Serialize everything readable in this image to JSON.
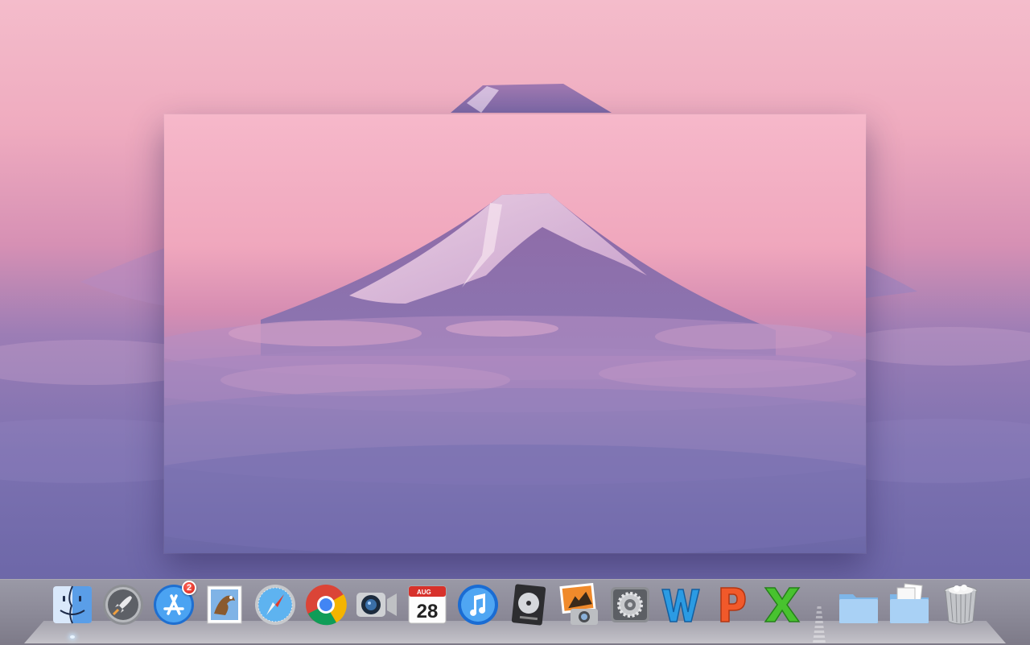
{
  "dock": {
    "apps": [
      {
        "id": "finder",
        "icon": "finder-icon",
        "running": true
      },
      {
        "id": "launchpad",
        "icon": "launchpad-rocket-icon",
        "running": false
      },
      {
        "id": "app-store",
        "icon": "app-store-icon",
        "running": false,
        "badge": "2"
      },
      {
        "id": "mail",
        "icon": "mail-stamp-eagle-icon",
        "running": false
      },
      {
        "id": "safari",
        "icon": "safari-compass-icon",
        "running": false
      },
      {
        "id": "chrome",
        "icon": "chrome-icon",
        "running": false
      },
      {
        "id": "facetime",
        "icon": "facetime-camera-icon",
        "running": false
      },
      {
        "id": "calendar",
        "icon": "calendar-icon",
        "running": false,
        "month": "AUG",
        "day": "28"
      },
      {
        "id": "itunes",
        "icon": "itunes-note-icon",
        "running": false
      },
      {
        "id": "dvd-player",
        "icon": "dvd-player-icon",
        "running": false
      },
      {
        "id": "iphoto",
        "icon": "iphoto-icon",
        "running": false
      },
      {
        "id": "system-preferences",
        "icon": "system-preferences-gear-icon",
        "running": false
      },
      {
        "id": "word",
        "icon": "word-w-icon",
        "running": false
      },
      {
        "id": "powerpoint",
        "icon": "powerpoint-p-icon",
        "running": false
      },
      {
        "id": "excel",
        "icon": "excel-x-icon",
        "running": false
      }
    ],
    "stacks": [
      {
        "id": "applications-folder",
        "icon": "folder-icon"
      },
      {
        "id": "documents-folder",
        "icon": "documents-folder-icon"
      },
      {
        "id": "trash",
        "icon": "trash-icon"
      }
    ]
  },
  "colors": {
    "sky_top": "#f2b6c6",
    "sky_mid": "#d98fb3",
    "clouds": "#6f6aa9",
    "mountain": "#7c5f9e",
    "snow": "#e6d6ec",
    "badge": "#d41c12"
  }
}
